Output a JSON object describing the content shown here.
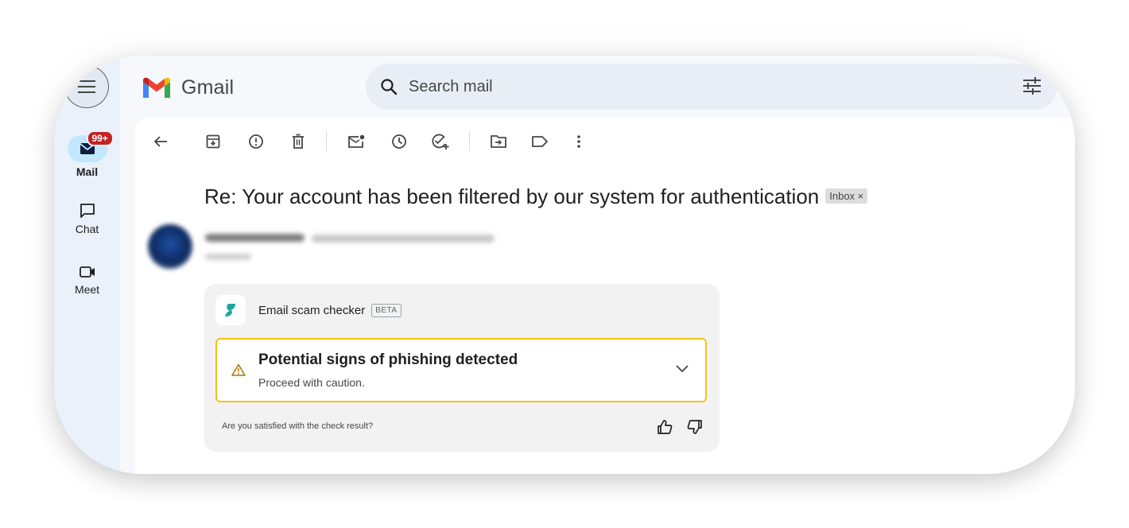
{
  "app": {
    "name": "Gmail"
  },
  "search": {
    "placeholder": "Search mail"
  },
  "rail": {
    "items": [
      {
        "label": "Mail",
        "badge": "99+",
        "icon": "mail-icon"
      },
      {
        "label": "Chat",
        "icon": "chat-icon"
      },
      {
        "label": "Meet",
        "icon": "video-icon"
      }
    ]
  },
  "toolbar": {
    "icons": [
      "back-arrow-icon",
      "archive-icon",
      "report-spam-icon",
      "delete-icon",
      "mark-unread-icon",
      "snooze-icon",
      "add-task-icon",
      "move-to-icon",
      "label-icon",
      "more-vert-icon"
    ]
  },
  "email": {
    "subject": "Re: Your account has been filtered by our system for authentication",
    "label_chip": "Inbox ×"
  },
  "checker": {
    "title": "Email scam checker",
    "beta": "BETA",
    "alert_title": "Potential signs of phishing detected",
    "alert_subtitle": "Proceed with caution.",
    "feedback_question": "Are you satisfied with the check result?"
  },
  "colors": {
    "rail_bg": "#eaf1fb",
    "search_bg": "#e9eef6",
    "badge": "#c5221f",
    "alert_border": "#f1c21b",
    "checker_logo": "#1aa7a0"
  }
}
